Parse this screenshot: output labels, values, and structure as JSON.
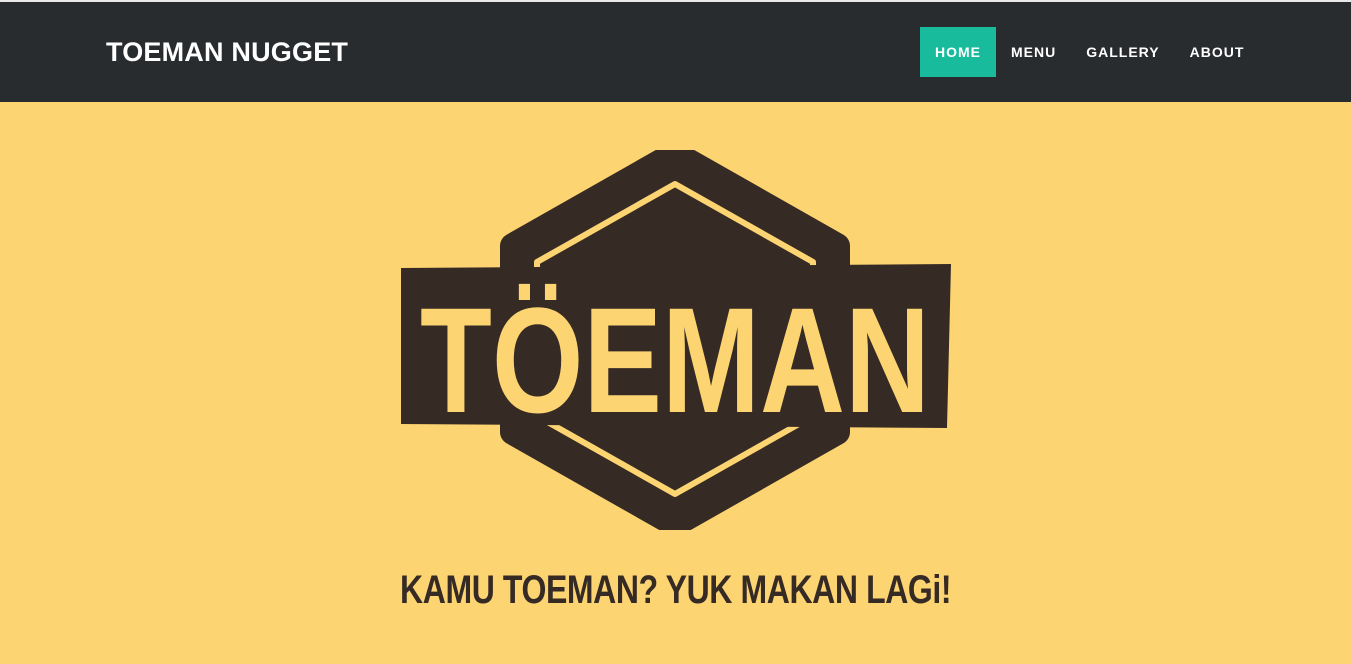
{
  "header": {
    "brand": "TOEMAN NUGGET",
    "nav": [
      {
        "label": "HOME",
        "active": true
      },
      {
        "label": "MENU",
        "active": false
      },
      {
        "label": "GALLERY",
        "active": false
      },
      {
        "label": "ABOUT",
        "active": false
      }
    ]
  },
  "hero": {
    "logo_text": "TÖEMAN",
    "tagline": "KAMU TOEMAN? YUK MAKAN LAGi!"
  },
  "colors": {
    "navbar": "#292c2f",
    "accent": "#18bc9c",
    "background": "#fdd472",
    "logo_dark": "#362a25"
  }
}
